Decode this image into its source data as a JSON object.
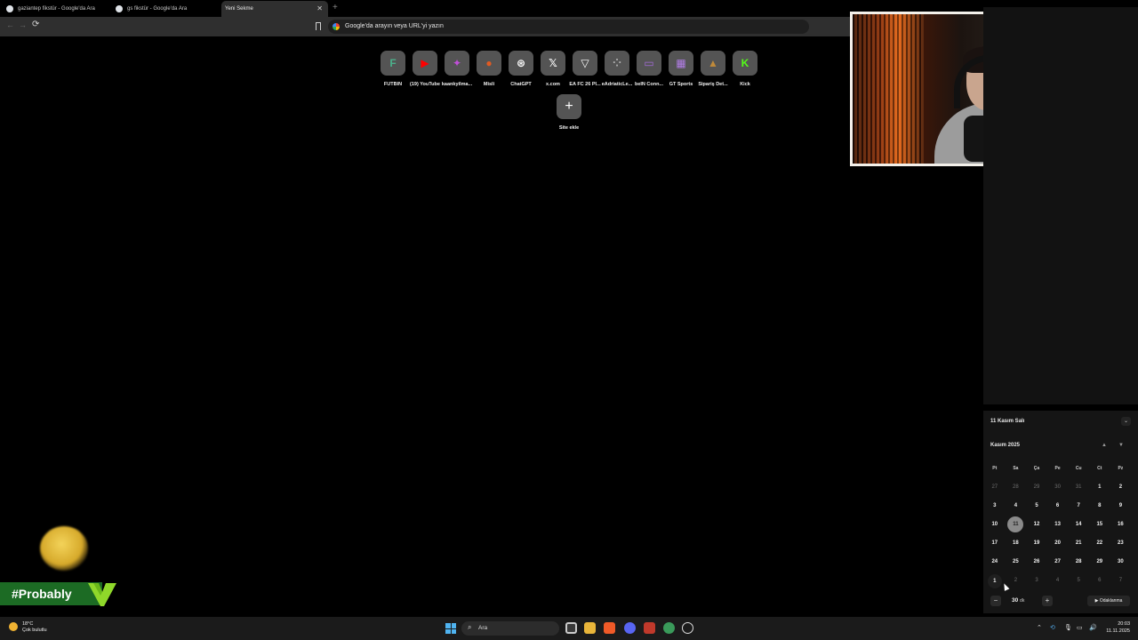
{
  "tabs": [
    {
      "title": "gaziantep fikstür - Google'da Ara"
    },
    {
      "title": "gs fikstür - Google'da Ara"
    },
    {
      "title": "Yeni Sekme",
      "active": true
    }
  ],
  "new_tab_symbol": "+",
  "toolbar": {
    "back_icon": "←",
    "forward_icon": "→",
    "reload_icon": "⟳",
    "omnibox_placeholder": "Google'da arayın veya URL'yi yazın"
  },
  "shortcuts": [
    {
      "label": "FUTBIN",
      "glyph": "F",
      "color": "#4caf8a"
    },
    {
      "label": "(19) YouTube",
      "glyph": "▶",
      "color": "#ff0000"
    },
    {
      "label": "kaankyilma...",
      "glyph": "✦",
      "color": "#c04fd8"
    },
    {
      "label": "Misli",
      "glyph": "●",
      "color": "#e05a22"
    },
    {
      "label": "ChatGPT",
      "glyph": "⊛",
      "color": "#ffffff"
    },
    {
      "label": "x.com",
      "glyph": "𝕏",
      "color": "#ffffff"
    },
    {
      "label": "EA FC 26 Pl...",
      "glyph": "▽",
      "color": "#ffffff"
    },
    {
      "label": "eAdriaticLe...",
      "glyph": "⁘",
      "color": "#b0b0b0"
    },
    {
      "label": "beIN Conn...",
      "glyph": "▭",
      "color": "#a46bd8"
    },
    {
      "label": "GT Sports",
      "glyph": "▦",
      "color": "#b37ee8"
    },
    {
      "label": "Sipariş Det...",
      "glyph": "▲",
      "color": "#c08a3a"
    },
    {
      "label": "Kick",
      "glyph": "K",
      "color": "#53fc18"
    }
  ],
  "add_site": {
    "glyph": "+",
    "label": "Site ekle"
  },
  "overlay": {
    "hashtag": "#Probably"
  },
  "calendar": {
    "date_header": "11 Kasım Salı",
    "collapse_icon": "⌄",
    "month_header": "Kasım 2025",
    "up_icon": "▲",
    "down_icon": "▼",
    "weekdays": [
      "Pt",
      "Sa",
      "Ça",
      "Pe",
      "Cu",
      "Ct",
      "Pz"
    ],
    "weeks": [
      [
        "27",
        "28",
        "29",
        "30",
        "31",
        "1",
        "2"
      ],
      [
        "3",
        "4",
        "5",
        "6",
        "7",
        "8",
        "9"
      ],
      [
        "10",
        "11",
        "12",
        "13",
        "14",
        "15",
        "16"
      ],
      [
        "17",
        "18",
        "19",
        "20",
        "21",
        "22",
        "23"
      ],
      [
        "24",
        "25",
        "26",
        "27",
        "28",
        "29",
        "30"
      ],
      [
        "1",
        "2",
        "3",
        "4",
        "5",
        "6",
        "7"
      ]
    ],
    "today": "11",
    "focus": {
      "minus": "−",
      "minutes": "30",
      "unit": "dk",
      "plus": "+",
      "button": "Odaklanma"
    }
  },
  "taskbar": {
    "weather_temp": "18°C",
    "weather_desc": "Çok bulutlu",
    "search_label": "Ara",
    "search_icon": "⌕",
    "tray_chevron": "⌃",
    "time": "20:03",
    "date": "11.11.2025"
  }
}
